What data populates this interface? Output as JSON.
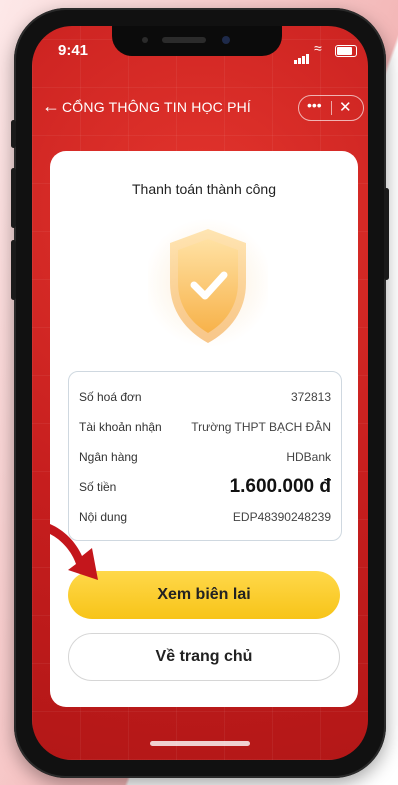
{
  "status_bar": {
    "time": "9:41"
  },
  "app_bar": {
    "title": "CỔNG THÔNG TIN HỌC PHÍ",
    "back_icon": "arrow-left-icon",
    "more_icon": "more-dots-icon",
    "close_icon": "close-icon"
  },
  "card": {
    "title": "Thanh toán thành công",
    "success_icon": "shield-check-icon",
    "details": [
      {
        "label": "Số hoá đơn",
        "value": "372813"
      },
      {
        "label": "Tài khoản nhận",
        "value": "Trường THPT BẠCH ĐẰN"
      },
      {
        "label": "Ngân hàng",
        "value": "HDBank"
      },
      {
        "label": "Số tiền",
        "value": "1.600.000 đ"
      },
      {
        "label": "Nội dung",
        "value": "EDP48390248239"
      }
    ]
  },
  "buttons": {
    "view_receipt": "Xem biên lai",
    "home": "Về trang chủ"
  },
  "colors": {
    "background_red": "#c61e1e",
    "primary_button": "#f7c418",
    "pointer_arrow": "#c4161c"
  }
}
